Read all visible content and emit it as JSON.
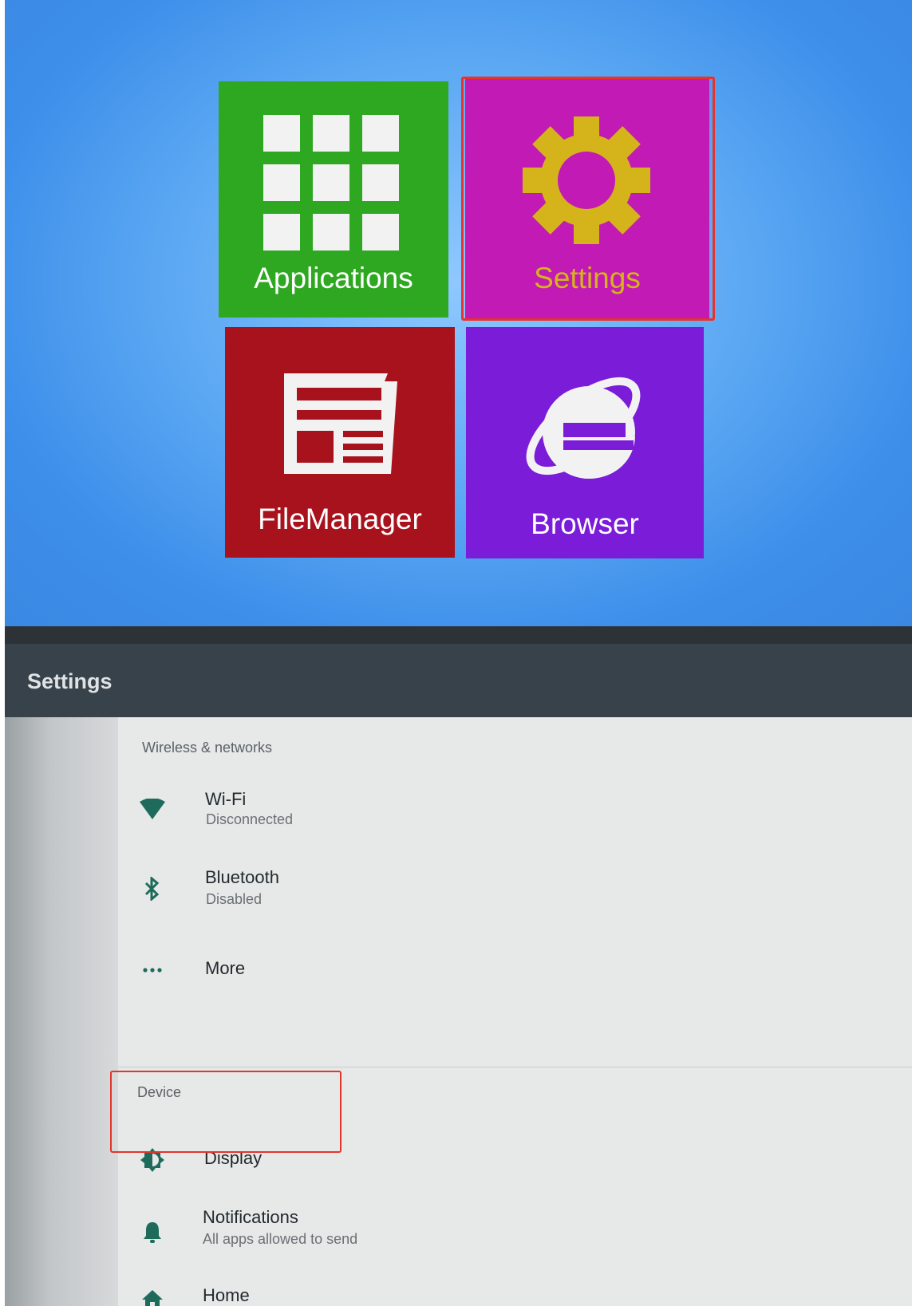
{
  "launcher": {
    "tiles": [
      {
        "label": "Applications",
        "icon": "grid-icon",
        "color": "#2ea820"
      },
      {
        "label": "Settings",
        "icon": "gear-icon",
        "color": "#c21ab4"
      },
      {
        "label": "FileManager",
        "icon": "document-icon",
        "color": "#a8121c"
      },
      {
        "label": "Browser",
        "icon": "internet-explorer-icon",
        "color": "#7a1cd8"
      }
    ],
    "highlight_color": "#e8322a"
  },
  "settings": {
    "title": "Settings",
    "sections": [
      {
        "header": "Wireless & networks",
        "items": [
          {
            "title": "Wi-Fi",
            "summary": "Disconnected",
            "icon": "wifi-icon"
          },
          {
            "title": "Bluetooth",
            "summary": "Disabled",
            "icon": "bluetooth-icon"
          },
          {
            "title": "More",
            "summary": "",
            "icon": "more-dots-icon"
          }
        ]
      },
      {
        "header": "Device",
        "items": [
          {
            "title": "Display",
            "summary": "",
            "icon": "brightness-icon"
          },
          {
            "title": "Notifications",
            "summary": "All apps allowed to send",
            "icon": "bell-icon"
          },
          {
            "title": "Home",
            "summary": "",
            "icon": "home-icon"
          }
        ]
      }
    ],
    "accent_color": "#1e6b5c"
  }
}
